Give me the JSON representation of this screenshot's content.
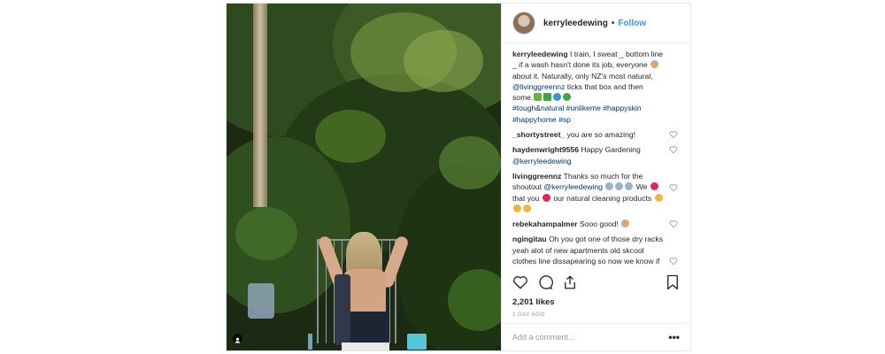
{
  "post": {
    "username": "kerryleedewing",
    "separator": "•",
    "follow_label": "Follow",
    "caption": {
      "username": "kerryleedewing",
      "text_1": "I train, I sweat _ bottom line _ if a wash hasn't done its job, everyone",
      "text_2": "about it. Naturally, only NZ's most natural,",
      "mention": "@livinggreennz",
      "text_3": "ticks that box and then some.",
      "hashtags": "#tough&natural #unlikeme #happyskin #happyhome #sp"
    },
    "comments": [
      {
        "username": "_shortystreet_",
        "text": "you are so amazing!"
      },
      {
        "username": "haydenwright9556",
        "text": "Happy Gardening",
        "mention": "@kerryleedewing"
      },
      {
        "username": "livinggreennz",
        "text_1": "Thanks so much for the shoutout",
        "mention": "@kerryleedewing",
        "text_2": "We",
        "text_3": "that you",
        "text_4": "our natural cleaning products"
      },
      {
        "username": "rebekahampalmer",
        "text": "Sooo good!"
      },
      {
        "username": "ngingitau",
        "text": "Oh you got one of those dry racks yeah alot of new apartments old skcool clothes line dissapearing so now we know if you walk past kerry"
      }
    ],
    "likes": "2,201 likes",
    "time_ago": "1 DAY AGO",
    "add_comment_placeholder": "Add a comment...",
    "more_label": "•••",
    "icons": [
      "heart-icon",
      "comment-icon",
      "share-icon",
      "bookmark-icon",
      "like-comment-heart-icon",
      "more-options-icon"
    ],
    "colors": {
      "link": "#3897f0",
      "mention": "#003569",
      "text": "#262626",
      "muted": "#999999",
      "border": "#efefef"
    }
  }
}
